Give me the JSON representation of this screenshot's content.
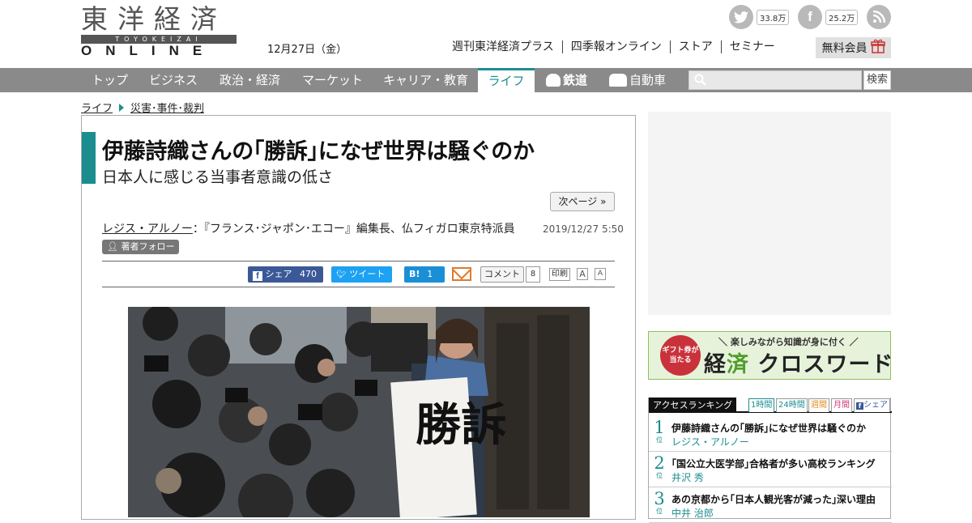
{
  "header": {
    "logo_kanji": "東洋経済",
    "logo_bar": "TOYOKEIZAI",
    "logo_en": "ONLINE",
    "date": "12月27日（金）",
    "social": [
      {
        "icon": "twitter-icon",
        "count": "33.8万"
      },
      {
        "icon": "facebook-icon",
        "count": "25.2万"
      },
      {
        "icon": "rss-icon"
      }
    ],
    "links": [
      "週刊東洋経済プラス",
      "四季報オンライン",
      "ストア",
      "セミナー"
    ],
    "member_label": "無料会員"
  },
  "nav": {
    "items": [
      "トップ",
      "ビジネス",
      "政治・経済",
      "マーケット",
      "キャリア・教育",
      "ライフ",
      "鉄道",
      "自動車"
    ],
    "active": "ライフ",
    "search_placeholder": "",
    "search_button": "検索"
  },
  "breadcrumb": [
    "ライフ",
    "災害･事件･裁判"
  ],
  "article": {
    "title": "伊藤詩織さんの｢勝訴｣になぜ世界は騒ぐのか",
    "subtitle": "日本人に感じる当事者意識の低さ",
    "next_page": "次ページ »",
    "author_name": "レジス・アルノー",
    "author_desc": "：『フランス･ジャポン･エコー』編集長、仏フィガロ東京特派員",
    "follow_label": "著者フォロー",
    "pubdate": "2019/12/27 5:50",
    "share": {
      "facebook": "シェア",
      "facebook_count": "470",
      "tweet": "ツイート",
      "hatena": "B!",
      "hatena_count": "1",
      "comment": "コメント",
      "comment_count": "8",
      "print": "印刷",
      "font_large": "A",
      "font_small": "A"
    },
    "photo_sign_text": "勝訴"
  },
  "sidebar": {
    "banner": {
      "circle": "ギフト券が当たる",
      "tagline": "＼ 楽しみながら知識が身に付く ／",
      "word_a": "経",
      "word_b": "済",
      "word_c": "クロスワード"
    },
    "ranking": {
      "title": "アクセスランキング",
      "tabs": [
        "1時間",
        "24時間",
        "週間",
        "月間",
        "シェア"
      ],
      "rank_suffix": "位",
      "items": [
        {
          "rank": "1",
          "title": "伊藤詩織さんの｢勝訴｣になぜ世界は騒ぐのか",
          "author": "レジス・アルノー"
        },
        {
          "rank": "2",
          "title": "｢国公立大医学部｣合格者が多い高校ランキング",
          "author": "井沢 秀"
        },
        {
          "rank": "3",
          "title": "あの京都から｢日本人観光客が減った｣深い理由",
          "author": "中井 治郎"
        }
      ]
    }
  },
  "colors": {
    "accent": "#1b8d8f",
    "nav_bg": "#8a8a8a",
    "facebook": "#3b5998",
    "twitter": "#1da1f2",
    "hatena": "#1b8fd6"
  }
}
